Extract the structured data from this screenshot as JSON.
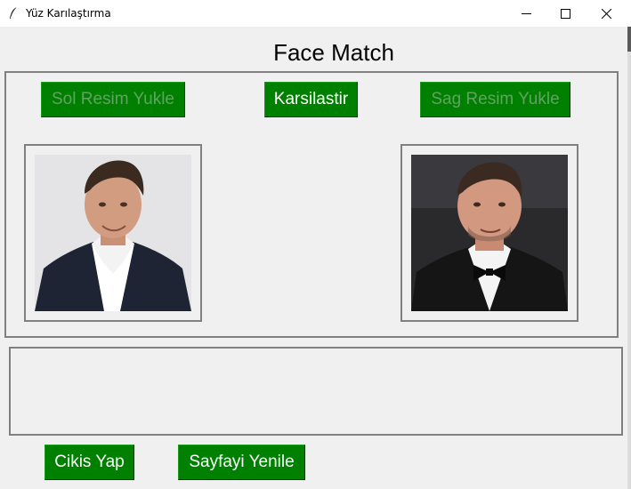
{
  "window": {
    "title": "Yüz Karılaştırma",
    "icon": "feather-icon",
    "controls": [
      "minimize-icon",
      "maximize-icon",
      "close-icon"
    ]
  },
  "main": {
    "heading": "Face Match",
    "buttons": {
      "load_left": "Sol Resim Yukle",
      "compare": "Karsilastir",
      "load_right": "Sag Resim Yukle"
    },
    "images": {
      "left": "portrait photo of a man in dark suit (front-facing)",
      "right": "portrait photo of a man in tuxedo with bow tie"
    },
    "result_text": ""
  },
  "footer": {
    "exit_label": "Cikis Yap",
    "refresh_label": "Sayfayi Yenile"
  },
  "colors": {
    "button_bg": "#008000",
    "button_text": "#ffffff",
    "button_text_disabled": "#63a163",
    "window_bg": "#f0f0f0",
    "frame_border": "#808080"
  }
}
